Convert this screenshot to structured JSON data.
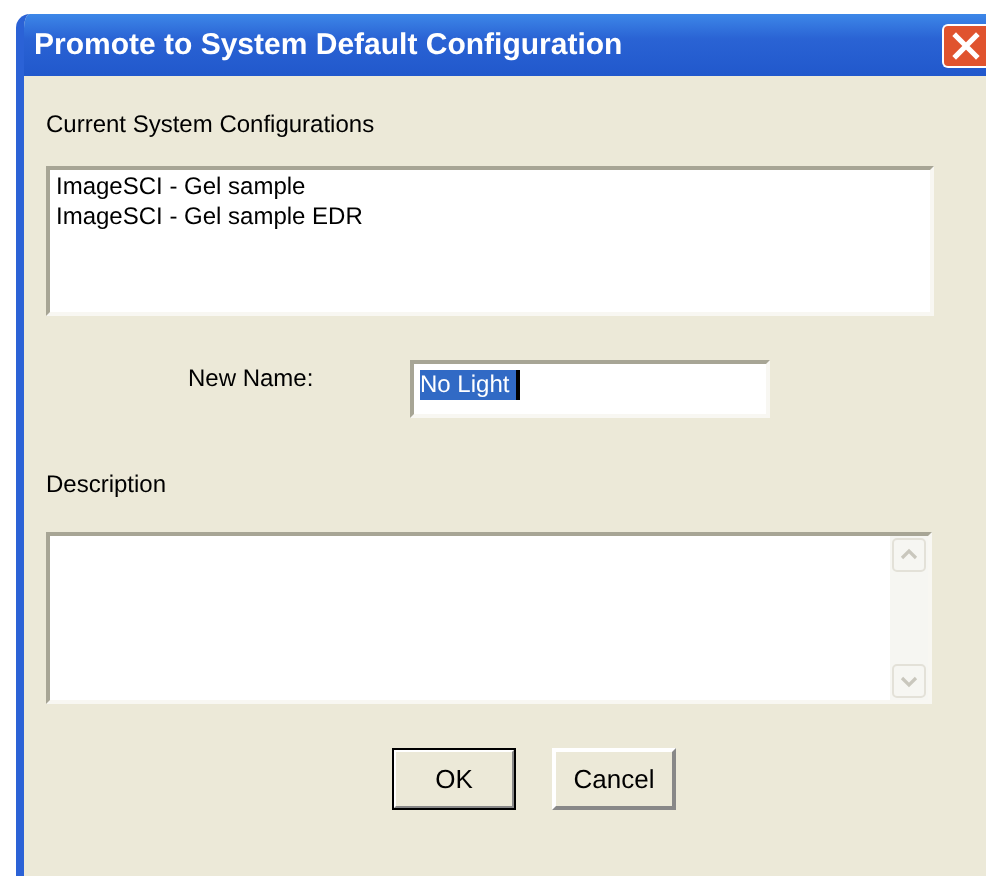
{
  "window": {
    "title": "Promote to System Default Configuration"
  },
  "configurations": {
    "label": "Current System Configurations",
    "items": [
      "ImageSCI - Gel sample",
      "ImageSCI - Gel sample EDR"
    ]
  },
  "new_name": {
    "label": "New Name:",
    "value": "No Light",
    "text_selected": true
  },
  "description": {
    "label": "Description"
  },
  "buttons": [
    {
      "label": "OK",
      "default": true
    },
    {
      "label": "Cancel",
      "default": false
    }
  ]
}
